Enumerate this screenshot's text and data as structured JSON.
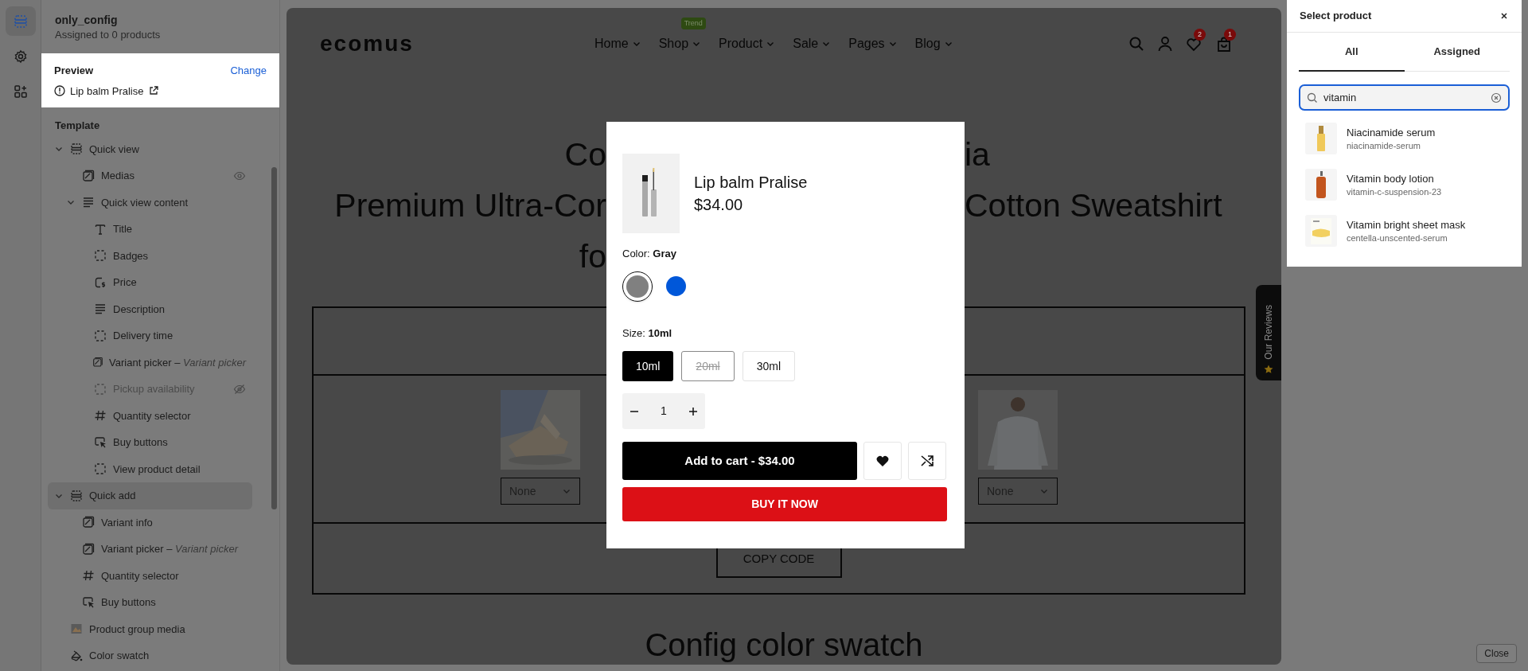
{
  "rail": {
    "items": [
      {
        "kind": "layout",
        "selected": true
      },
      {
        "kind": "settings",
        "selected": false
      },
      {
        "kind": "apps",
        "selected": false
      }
    ]
  },
  "config": {
    "name": "only_config",
    "subtitle": "Assigned to 0 products"
  },
  "preview": {
    "label": "Preview",
    "action": "Change",
    "product": "Lip balm Pralise"
  },
  "template": {
    "title": "Template",
    "items": [
      {
        "label": "Quick view",
        "kind": "section",
        "expanded": true,
        "selected": false,
        "hidden": false,
        "hovered": false,
        "children": [
          {
            "label": "Medias",
            "selected": false,
            "hidden": false,
            "hovered": true
          },
          {
            "label": "Quick view content",
            "kind": "lines",
            "expanded": true,
            "selected": false,
            "hidden": false,
            "hovered": false,
            "children": [
              {
                "label": "Title",
                "kind": "text",
                "selected": false,
                "hidden": false,
                "hovered": false
              },
              {
                "label": "Badges",
                "kind": "dashed",
                "selected": false,
                "hidden": false,
                "hovered": false
              },
              {
                "label": "Price",
                "kind": "price",
                "selected": false,
                "hidden": false,
                "hovered": false
              },
              {
                "label": "Description",
                "kind": "lines",
                "selected": false,
                "hidden": false,
                "hovered": false
              },
              {
                "label": "Delivery time",
                "kind": "dashed",
                "selected": false,
                "hidden": false,
                "hovered": false
              },
              {
                "label": "Variant picker – *Variant picker*",
                "selected": false,
                "hidden": false,
                "hovered": false
              },
              {
                "label": "Pickup availability",
                "kind": "dashed",
                "selected": false,
                "hidden": true,
                "hovered": false
              },
              {
                "label": "Quantity selector",
                "kind": "hash",
                "selected": false,
                "hidden": false,
                "hovered": false
              },
              {
                "label": "Buy buttons",
                "kind": "cursor",
                "selected": false,
                "hidden": false,
                "hovered": false
              },
              {
                "label": "View product detail",
                "kind": "dashed",
                "selected": false,
                "hidden": false,
                "hovered": false
              }
            ]
          }
        ]
      },
      {
        "label": "Quick add",
        "kind": "section",
        "expanded": true,
        "selected": true,
        "hidden": false,
        "hovered": false,
        "children": [
          {
            "label": "Variant info",
            "selected": false,
            "hidden": false,
            "hovered": false
          },
          {
            "label": "Variant picker – *Variant picker*",
            "selected": false,
            "hidden": false,
            "hovered": false
          },
          {
            "label": "Quantity selector",
            "kind": "hash",
            "selected": false,
            "hidden": false,
            "hovered": false
          },
          {
            "label": "Buy buttons",
            "kind": "cursor",
            "selected": false,
            "hidden": false,
            "hovered": false
          }
        ]
      },
      {
        "label": "Product group media",
        "kind": "media",
        "selected": false,
        "hidden": false,
        "hovered": false
      },
      {
        "label": "Color swatch",
        "kind": "swatch",
        "selected": false,
        "hidden": false,
        "hovered": false
      }
    ]
  },
  "storefront": {
    "logo": "ecomus",
    "nav": [
      {
        "label": "Home"
      },
      {
        "label": "Shop",
        "badge": "Trend"
      },
      {
        "label": "Product"
      },
      {
        "label": "Sale"
      },
      {
        "label": "Pages"
      },
      {
        "label": "Blog"
      }
    ],
    "wishlist_count": "2",
    "cart_count": "1",
    "heading_lines": [
      {
        "left": "Co",
        "right": "ia"
      },
      {
        "left": "Premium Ultra-Cor",
        "right": "Cotton Sweatshirt"
      },
      {
        "left": "fo"
      }
    ],
    "selects": [
      "None",
      "None"
    ],
    "copy_button": "COPY CODE",
    "next_heading": "Config color swatch",
    "reviews_tab": "Our Reviews"
  },
  "quick_view": {
    "title": "Lip balm Pralise",
    "price": "$34.00",
    "color_label": "Color: **Gray**",
    "swatches": [
      {
        "color": "#808080",
        "selected": true
      },
      {
        "color": "#0057d9",
        "selected": false
      }
    ],
    "size_label": "Size: **10ml**",
    "sizes": [
      {
        "label": "10ml",
        "selected": true,
        "available": true
      },
      {
        "label": "20ml",
        "selected": false,
        "available": false
      },
      {
        "label": "30ml",
        "selected": false,
        "available": true
      }
    ],
    "quantity": "1",
    "add_to_cart": "Add to cart - $34.00",
    "buy_now": "BUY IT NOW"
  },
  "picker": {
    "title": "Select product",
    "tabs": [
      {
        "label": "All",
        "selected": true
      },
      {
        "label": "Assigned",
        "selected": false
      }
    ],
    "search": {
      "value": "vitamin"
    },
    "results": [
      {
        "name": "Niacinamide serum",
        "handle": "niacinamide-serum"
      },
      {
        "name": "Vitamin body lotion",
        "handle": "vitamin-c-suspension-23"
      },
      {
        "name": "Vitamin bright sheet mask",
        "handle": "centella-unscented-serum"
      }
    ],
    "close_button": "Close"
  }
}
